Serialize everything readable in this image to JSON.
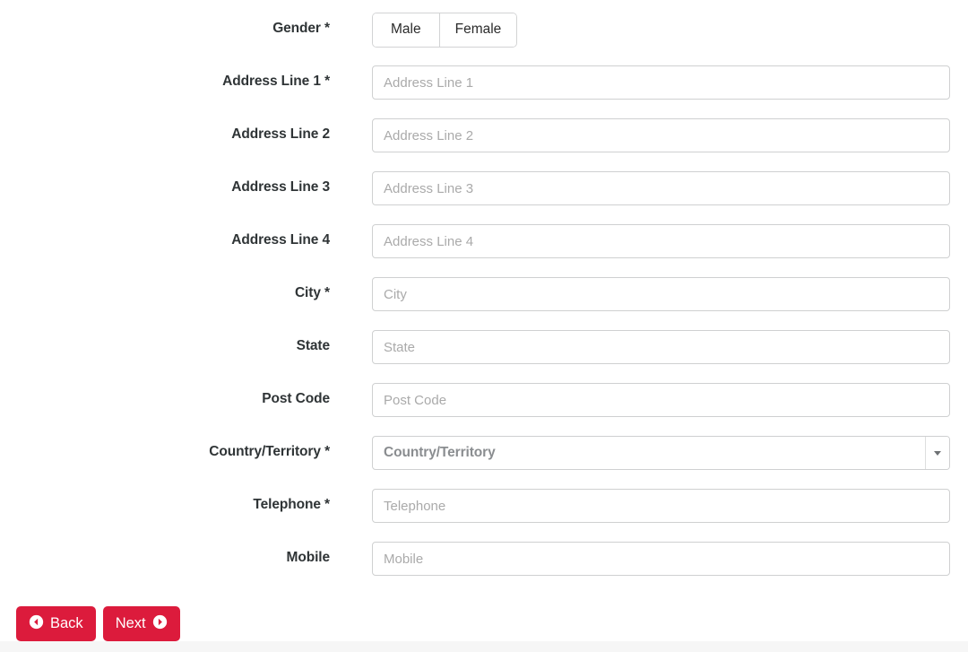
{
  "form": {
    "gender": {
      "label": "Gender *",
      "options": [
        {
          "label": "Male",
          "name": "gender-option-male"
        },
        {
          "label": "Female",
          "name": "gender-option-female"
        }
      ]
    },
    "fields": [
      {
        "label": "Address Line 1 *",
        "placeholder": "Address Line 1",
        "value": "",
        "name": "address-line-1"
      },
      {
        "label": "Address Line 2",
        "placeholder": "Address Line 2",
        "value": "",
        "name": "address-line-2"
      },
      {
        "label": "Address Line 3",
        "placeholder": "Address Line 3",
        "value": "",
        "name": "address-line-3"
      },
      {
        "label": "Address Line 4",
        "placeholder": "Address Line 4",
        "value": "",
        "name": "address-line-4"
      },
      {
        "label": "City *",
        "placeholder": "City",
        "value": "",
        "name": "city"
      },
      {
        "label": "State",
        "placeholder": "State",
        "value": "",
        "name": "state"
      },
      {
        "label": "Post Code",
        "placeholder": "Post Code",
        "value": "",
        "name": "post-code"
      }
    ],
    "country": {
      "label": "Country/Territory *",
      "selected": "Country/Territory",
      "arrow_icon": "chevron-down-icon"
    },
    "fields_after_country": [
      {
        "label": "Telephone *",
        "placeholder": "Telephone",
        "value": "",
        "name": "telephone"
      },
      {
        "label": "Mobile",
        "placeholder": "Mobile",
        "value": "",
        "name": "mobile"
      }
    ]
  },
  "navigation": {
    "back": {
      "label": "Back",
      "icon": "circle-chevron-left-icon"
    },
    "next": {
      "label": "Next",
      "icon": "circle-chevron-right-icon"
    }
  },
  "colors": {
    "button_red": "#dc1b3c",
    "label_text": "#2f3436",
    "placeholder": "#aaaaaa",
    "input_border": "#cfd0d1",
    "footer_strip": "#f6f6f6"
  }
}
